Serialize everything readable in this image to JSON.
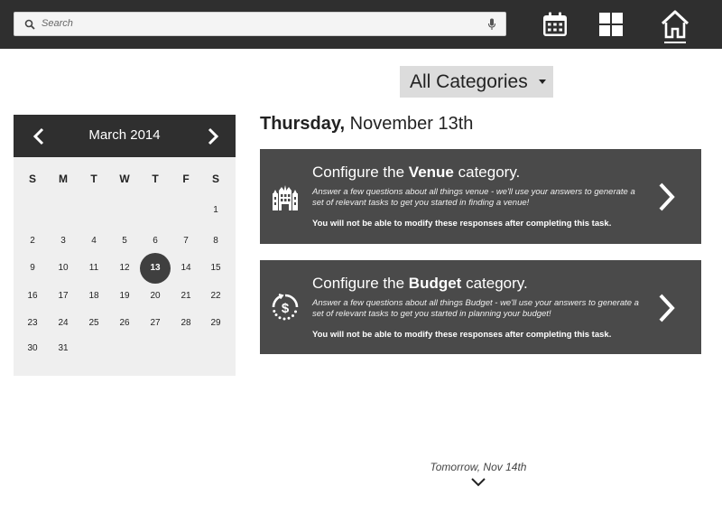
{
  "search": {
    "placeholder": "Search"
  },
  "nav": {
    "icons": [
      "calendar-icon",
      "grid-icon",
      "home-icon"
    ],
    "active": "home-icon"
  },
  "filter": {
    "label": "All Categories"
  },
  "calendar": {
    "month_label": "March 2014",
    "weekdays": [
      "S",
      "M",
      "T",
      "W",
      "T",
      "F",
      "S"
    ],
    "weeks": [
      [
        "",
        "",
        "",
        "",
        "",
        "",
        "1"
      ],
      [
        "2",
        "3",
        "4",
        "5",
        "6",
        "7",
        "8"
      ],
      [
        "9",
        "10",
        "11",
        "12",
        "13",
        "14",
        "15"
      ],
      [
        "16",
        "17",
        "18",
        "19",
        "20",
        "21",
        "22"
      ],
      [
        "23",
        "24",
        "25",
        "26",
        "27",
        "28",
        "29"
      ],
      [
        "30",
        "31",
        "",
        "",
        "",
        "",
        ""
      ]
    ],
    "selected_day": "13"
  },
  "day": {
    "weekday": "Thursday,",
    "date": " November 13th"
  },
  "tasks": [
    {
      "title_prefix": "Configure the ",
      "title_strong": "Venue",
      "title_suffix": " category.",
      "description": "Answer a few questions about all things venue - we'll use your answers to generate a set of relevant tasks to get you started in finding a venue!",
      "note": "You will not be able to modify these responses after completing this task.",
      "icon": "venue-building-icon"
    },
    {
      "title_prefix": "Configure the ",
      "title_strong": "Budget",
      "title_suffix": " category.",
      "description": "Answer a few questions about all things Budget - we'll use your answers to generate a set of relevant tasks to get you started in planning your budget!",
      "note": "You will not be able to modify these responses after completing this task.",
      "icon": "budget-dollar-icon"
    }
  ],
  "tomorrow": {
    "label": "Tomorrow, Nov 14th"
  },
  "colors": {
    "dark": "#2f2f2f",
    "card": "#4a4a4a",
    "panel": "#efefef",
    "dropdown": "#dcdcdc"
  }
}
